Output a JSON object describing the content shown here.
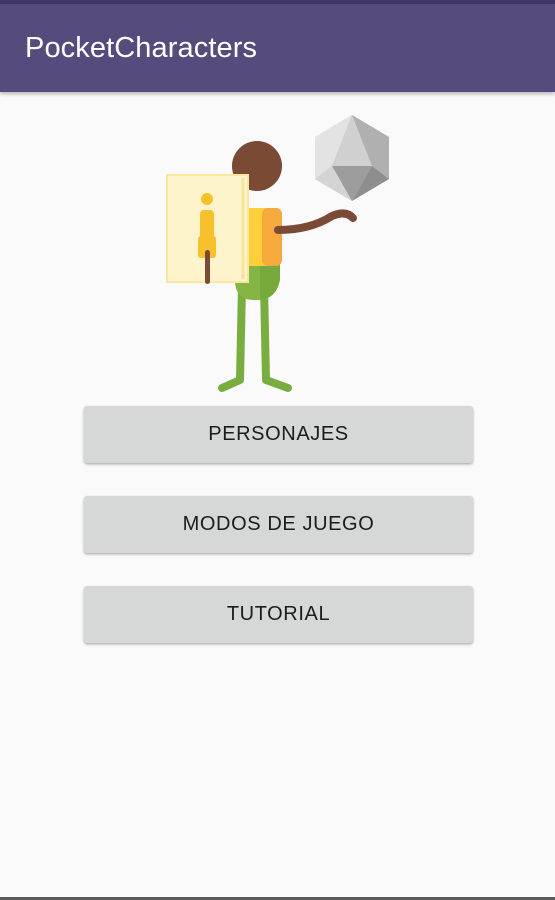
{
  "app_bar": {
    "title": "PocketCharacters"
  },
  "illustration": {
    "icon": "character-with-card-and-dice-icon"
  },
  "menu": {
    "buttons": [
      {
        "label": "PERSONAJES"
      },
      {
        "label": "MODOS DE JUEGO"
      },
      {
        "label": "TUTORIAL"
      }
    ]
  },
  "colors": {
    "primary": "#574b7e",
    "primary_dark": "#3f3766",
    "background": "#fafafa",
    "button_bg": "#d6d7d7",
    "button_text": "#1c1c1c"
  }
}
